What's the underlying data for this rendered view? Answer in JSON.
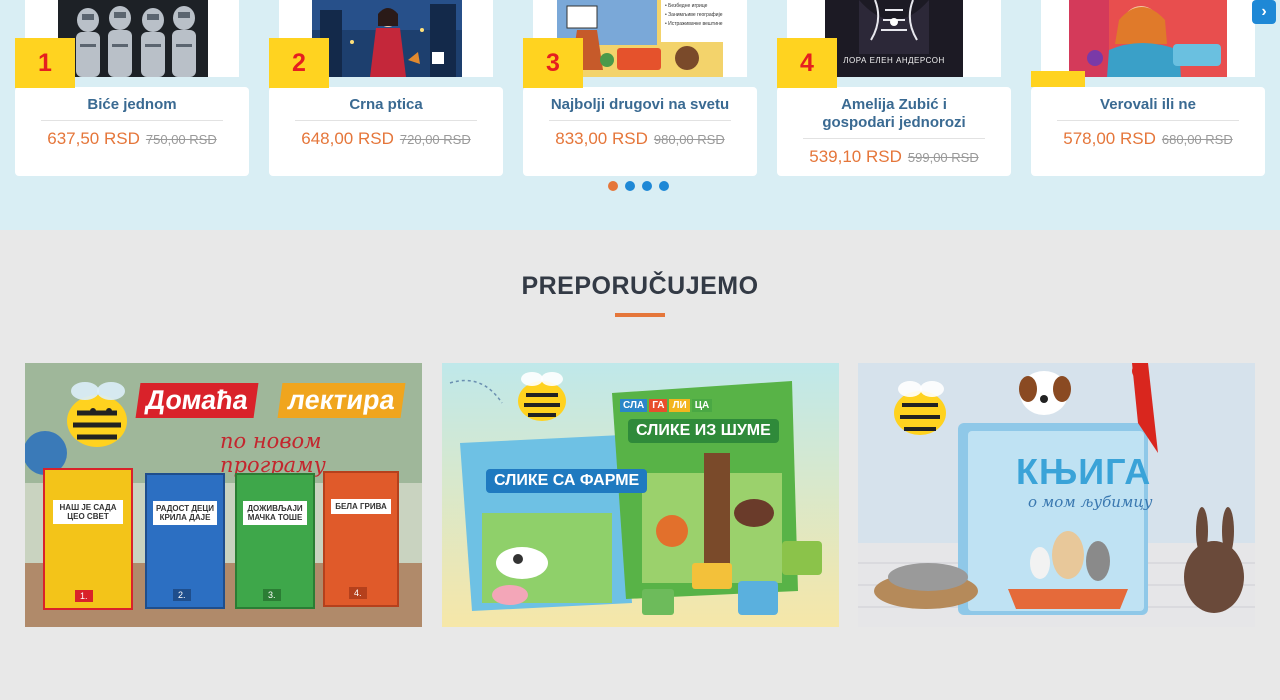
{
  "bestsellers": {
    "items": [
      {
        "rank": "1",
        "title": "Biće jednom",
        "price": "637,50 RSD",
        "old_price": "750,00 RSD"
      },
      {
        "rank": "2",
        "title": "Crna ptica",
        "price": "648,00 RSD",
        "old_price": "720,00 RSD"
      },
      {
        "rank": "3",
        "title": "Najbolji drugovi na svetu",
        "price": "833,00 RSD",
        "old_price": "980,00 RSD"
      },
      {
        "rank": "4",
        "title": "Amelija Zubić i gospodari jednorozi",
        "price": "539,10 RSD",
        "old_price": "599,00 RSD"
      },
      {
        "rank": "",
        "title": "Verovali ili ne",
        "price": "578,00 RSD",
        "old_price": "680,00 RSD"
      }
    ],
    "cover_texts": {
      "book3_lines": [
        "• Безбедне игрице",
        "• Занимљиве географије",
        "• Истраживачке вештине"
      ],
      "book4_author": "ЛОРА ЕЛЕН АНДЕРСОН"
    },
    "next_icon": "chevron-right-icon",
    "pagination": {
      "count": 4,
      "active": 0
    }
  },
  "recommended": {
    "title": "PREPORUČUJEMO",
    "banners": [
      {
        "title_part1": "Домаћа",
        "title_part2": "лектира",
        "subtitle": "по новом програму",
        "books": [
          "НАШ ЈЕ САДА ЦЕО СВЕТ",
          "РАДОСТ ДЕЦИ КРИЛА ДАЈЕ",
          "ДОЖИВЉАЈИ МАЧКА ТОШЕ",
          "БЕЛА ГРИВА"
        ],
        "grades": [
          "1.",
          "2.",
          "3.",
          "4."
        ]
      },
      {
        "series": [
          "СЛА",
          "ГА",
          "ЛИ",
          "ЦА"
        ],
        "book1": "СЛИКЕ СА ФАРМЕ",
        "book2": "СЛИКЕ ИЗ ШУМЕ"
      },
      {
        "title": "КЊИГА",
        "subtitle": "о мом љубимцу"
      }
    ]
  },
  "colors": {
    "carousel_bg": "#d9eef4",
    "title_blue": "#3a6a92",
    "price_orange": "#e5763a",
    "rank_yellow": "#ffd320",
    "rank_red": "#e51f1f",
    "accent_blue": "#1e88d6"
  }
}
